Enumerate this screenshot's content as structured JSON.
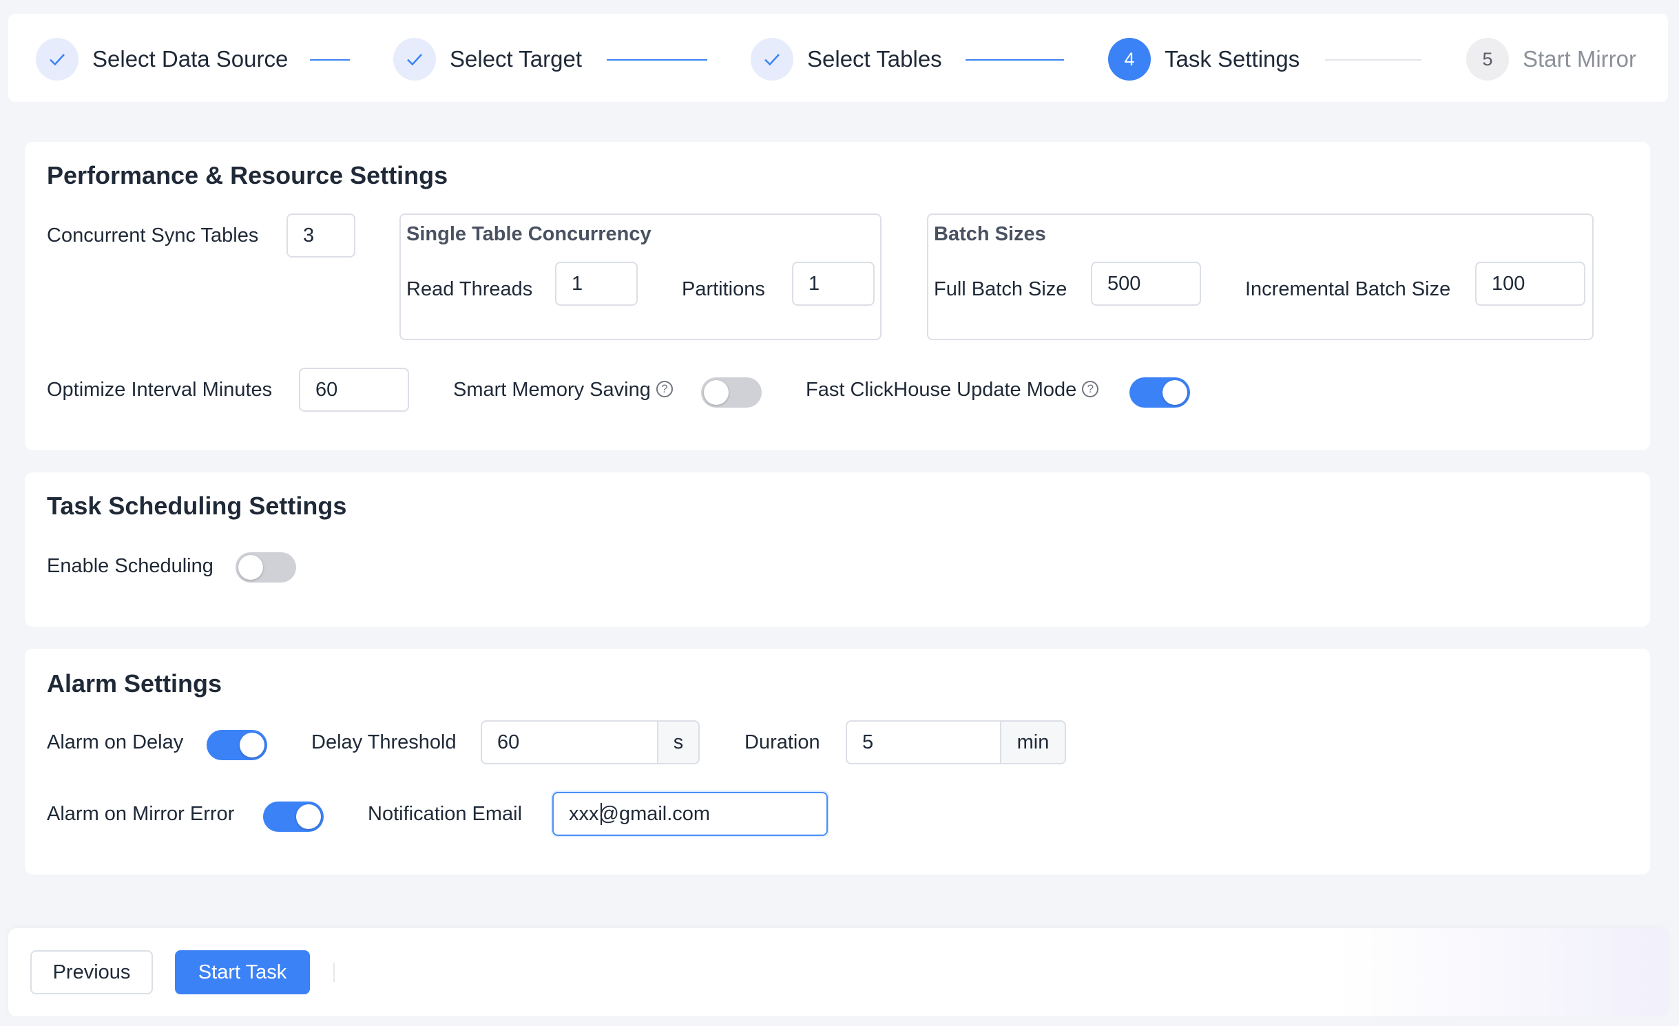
{
  "steps": [
    {
      "label": "Select Data Source",
      "status": "done",
      "icon": "check-icon"
    },
    {
      "label": "Select Target",
      "status": "done",
      "icon": "check-icon"
    },
    {
      "label": "Select Tables",
      "status": "done",
      "icon": "check-icon"
    },
    {
      "label": "Task Settings",
      "status": "active",
      "number": "4"
    },
    {
      "label": "Start Mirror",
      "status": "pending",
      "number": "5"
    }
  ],
  "performance": {
    "title": "Performance & Resource Settings",
    "concurrent_sync_tables": {
      "label": "Concurrent Sync Tables",
      "value": "3"
    },
    "single_table_concurrency": {
      "title": "Single Table Concurrency",
      "read_threads": {
        "label": "Read Threads",
        "value": "1"
      },
      "partitions": {
        "label": "Partitions",
        "value": "1"
      }
    },
    "batch_sizes": {
      "title": "Batch Sizes",
      "full_batch_size": {
        "label": "Full Batch Size",
        "value": "500"
      },
      "incremental_batch_size": {
        "label": "Incremental Batch Size",
        "value": "100"
      }
    },
    "optimize_interval": {
      "label": "Optimize Interval Minutes",
      "value": "60"
    },
    "smart_memory_saving": {
      "label": "Smart Memory Saving",
      "enabled": false,
      "help_icon": "?"
    },
    "fast_clickhouse_update": {
      "label": "Fast ClickHouse Update Mode",
      "enabled": true,
      "help_icon": "?"
    }
  },
  "scheduling": {
    "title": "Task Scheduling Settings",
    "enable_scheduling": {
      "label": "Enable Scheduling",
      "enabled": false
    }
  },
  "alarm": {
    "title": "Alarm Settings",
    "alarm_on_delay": {
      "label": "Alarm on Delay",
      "enabled": true
    },
    "delay_threshold": {
      "label": "Delay Threshold",
      "value": "60",
      "unit": "s"
    },
    "duration": {
      "label": "Duration",
      "value": "5",
      "unit": "min"
    },
    "alarm_on_mirror_error": {
      "label": "Alarm on Mirror Error",
      "enabled": true
    },
    "notification_email": {
      "label": "Notification Email",
      "value": "xxx@gmail.com"
    }
  },
  "footer": {
    "previous_label": "Previous",
    "start_task_label": "Start Task"
  },
  "colors": {
    "primary": "#3b82f6",
    "toggle_off": "#cfd1d6",
    "done_step_bg": "#e6ecfb"
  }
}
